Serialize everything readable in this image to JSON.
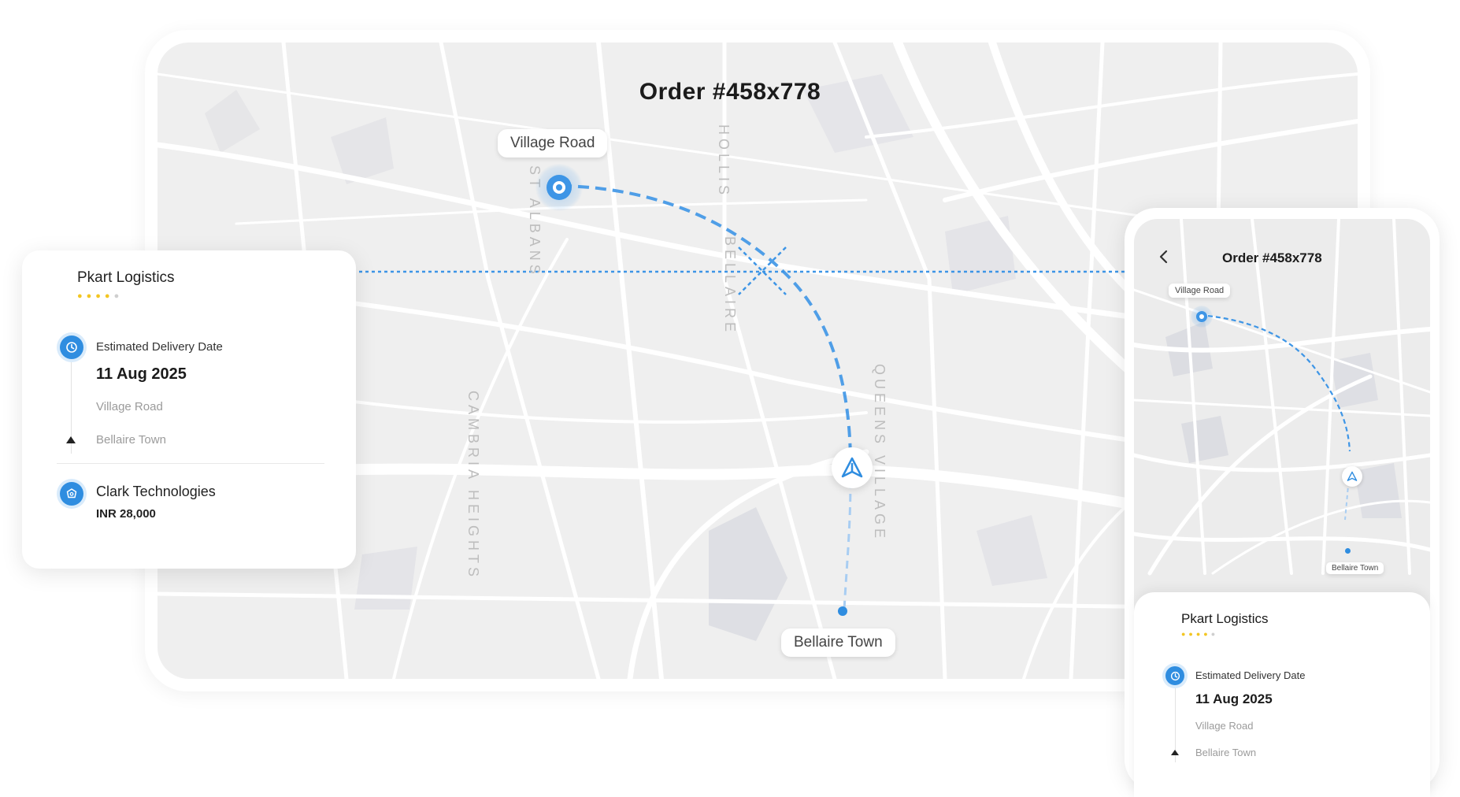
{
  "order_title": "Order #458x778",
  "map": {
    "origin_label": "Village Road",
    "destination_label": "Bellaire Town",
    "streets": [
      "HOLLIS",
      "ST ALBANS",
      "BELLAIRE",
      "CAMBRIA HEIGHTS",
      "QUEENS VILLAGE"
    ]
  },
  "card": {
    "company": "Pkart Logistics",
    "rating": "4 of 5 stars",
    "eta_label": "Estimated Delivery Date",
    "eta_date": "11 Aug 2025",
    "from": "Village Road",
    "to": "Bellaire Town",
    "client": "Clark Technologies",
    "amount": "INR 28,000"
  },
  "phone": {
    "back_icon": "chevron-left-icon",
    "title": "Order #458x778",
    "origin_label": "Village Road",
    "destination_label": "Bellaire Town",
    "company": "Pkart Logistics",
    "eta_label": "Estimated Delivery Date",
    "eta_date": "11 Aug 2025",
    "from": "Village Road",
    "to": "Bellaire Town"
  },
  "colors": {
    "accent": "#2f8de0",
    "route": "#3d95e6",
    "star": "#f3c623",
    "map_bg": "#efefef"
  }
}
